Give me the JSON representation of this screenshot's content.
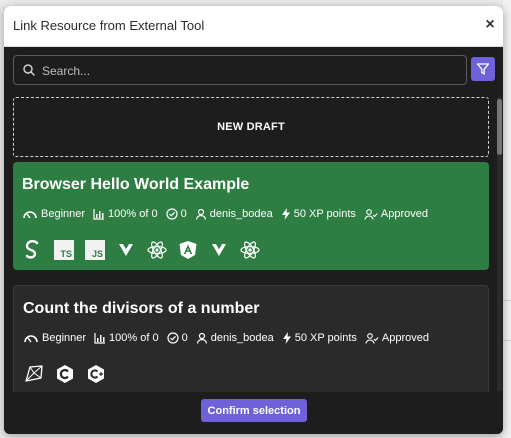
{
  "modal": {
    "title": "Link Resource from External Tool",
    "close_glyph": "×"
  },
  "search": {
    "placeholder": "Search..."
  },
  "new_draft": {
    "label": "NEW DRAFT"
  },
  "cards": [
    {
      "title": "Browser Hello World Example",
      "selected": true,
      "difficulty": "Beginner",
      "progress": "100% of 0",
      "checks": "0",
      "author": "denis_bodea",
      "xp": "50 XP points",
      "status": "Approved",
      "technologies": [
        "svelte-icon",
        "typescript-icon",
        "javascript-icon",
        "vue-icon",
        "react-icon",
        "angular-icon",
        "vue-icon",
        "react-icon"
      ],
      "tech_labels": [
        "TS",
        "JS"
      ]
    },
    {
      "title": "Count the divisors of a number",
      "selected": false,
      "difficulty": "Beginner",
      "progress": "100% of 0",
      "checks": "0",
      "author": "denis_bodea",
      "xp": "50 XP points",
      "status": "Approved",
      "technologies": [
        "ruby-icon",
        "c-icon",
        "cpp-icon"
      ]
    }
  ],
  "footer": {
    "confirm_label": "Confirm selection"
  },
  "colors": {
    "accent": "#6f61d9",
    "selected_card": "#2e7d43",
    "card": "#2a2a2a",
    "modal_bg": "#1d1d1d"
  }
}
